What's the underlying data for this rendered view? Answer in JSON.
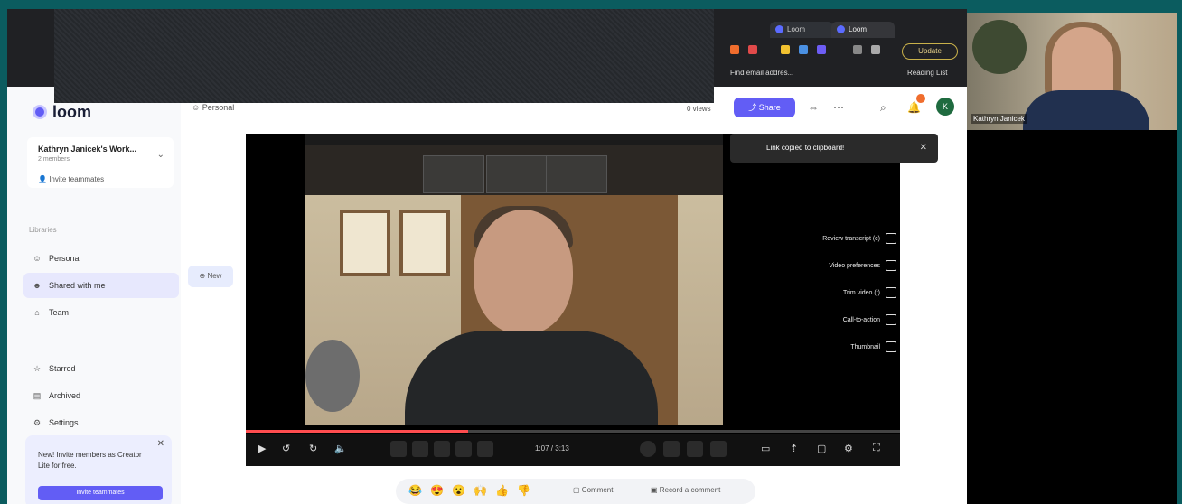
{
  "browser": {
    "tabs": [
      {
        "label": "Loom"
      },
      {
        "label": "Loom"
      }
    ],
    "update_label": "Update",
    "bookmarks": [
      {
        "label": "Find email addres..."
      },
      {
        "label": "Reading List"
      }
    ]
  },
  "sidebar": {
    "logo": "loom",
    "workspace_name": "Kathryn Janicek's Work...",
    "workspace_members": "2 members",
    "invite_label": "Invite teammates",
    "section_label": "Libraries",
    "items": [
      {
        "label": "Personal",
        "icon": "person-icon"
      },
      {
        "label": "Shared with me",
        "icon": "people-icon"
      },
      {
        "label": "Team",
        "icon": "team-icon"
      },
      {
        "label": "Starred",
        "icon": "star-icon"
      },
      {
        "label": "Archived",
        "icon": "archive-icon"
      },
      {
        "label": "Settings",
        "icon": "gear-icon"
      }
    ],
    "promo_text": "New! Invite members as Creator Lite for free.",
    "promo_button": "Invite teammates"
  },
  "header": {
    "breadcrumb": "Personal",
    "views": "0 views",
    "share_label": "Share",
    "avatar_initial": "K"
  },
  "new_label": "New",
  "player": {
    "toast": "Link copied to clipboard!",
    "menu": [
      {
        "label": "Review transcript (c)"
      },
      {
        "label": "Video preferences"
      },
      {
        "label": "Trim video (t)"
      },
      {
        "label": "Call-to-action"
      },
      {
        "label": "Thumbnail"
      }
    ],
    "timecode": "1:07 / 3:13",
    "progress": 0.34
  },
  "reactions": {
    "emojis": [
      "😂",
      "😍",
      "😮",
      "🙌",
      "👍",
      "👎"
    ],
    "comment_label": "Comment",
    "record_label": "Record a comment"
  },
  "webcam": {
    "name": "Kathryn Janicek"
  }
}
